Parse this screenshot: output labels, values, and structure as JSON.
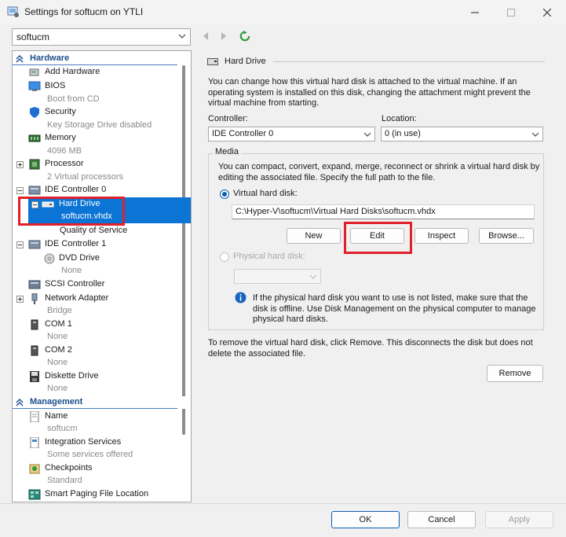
{
  "window": {
    "title": "Settings for softucm on YTLI",
    "controls": {
      "minimize": "minimize-icon",
      "maximize": "maximize-icon",
      "close": "close-icon"
    }
  },
  "toolbar": {
    "vm_selector_value": "softucm",
    "icons": [
      "back-arrow-icon",
      "forward-arrow-icon",
      "refresh-icon"
    ]
  },
  "tree": {
    "hardware_section": "Hardware",
    "management_section": "Management",
    "items": {
      "add_hardware": "Add Hardware",
      "bios": "BIOS",
      "bios_sub": "Boot from CD",
      "security": "Security",
      "security_sub": "Key Storage Drive disabled",
      "memory": "Memory",
      "memory_sub": "4096 MB",
      "processor": "Processor",
      "processor_sub": "2 Virtual processors",
      "ide0": "IDE Controller 0",
      "hard_drive": "Hard Drive",
      "hard_drive_sub": "softucm.vhdx",
      "qos": "Quality of Service",
      "ide1": "IDE Controller 1",
      "dvd": "DVD Drive",
      "dvd_sub": "None",
      "scsi": "SCSI Controller",
      "network": "Network Adapter",
      "network_sub": "Bridge",
      "com1": "COM 1",
      "com1_sub": "None",
      "com2": "COM 2",
      "com2_sub": "None",
      "diskette": "Diskette Drive",
      "diskette_sub": "None",
      "name": "Name",
      "name_sub": "softucm",
      "integration": "Integration Services",
      "integration_sub": "Some services offered",
      "checkpoints": "Checkpoints",
      "checkpoints_sub": "Standard",
      "smart_paging": "Smart Paging File Location"
    }
  },
  "detail": {
    "header": "Hard Drive",
    "intro": "You can change how this virtual hard disk is attached to the virtual machine. If an operating system is installed on this disk, changing the attachment might prevent the virtual machine from starting.",
    "controller_label": "Controller:",
    "controller_value": "IDE Controller 0",
    "location_label": "Location:",
    "location_value": "0 (in use)",
    "media_label": "Media",
    "media_text": "You can compact, convert, expand, merge, reconnect or shrink a virtual hard disk by editing the associated file. Specify the full path to the file.",
    "vhd_label": "Virtual hard disk:",
    "vhd_path": "C:\\Hyper-V\\softucm\\Virtual Hard Disks\\softucm.vhdx",
    "btn_new": "New",
    "btn_edit": "Edit",
    "btn_inspect": "Inspect",
    "btn_browse": "Browse...",
    "phys_label": "Physical hard disk:",
    "info_text": "If the physical hard disk you want to use is not listed, make sure that the disk is offline. Use Disk Management on the physical computer to manage physical hard disks.",
    "remove_text": "To remove the virtual hard disk, click Remove. This disconnects the disk but does not delete the associated file.",
    "btn_remove": "Remove"
  },
  "footer": {
    "ok": "OK",
    "cancel": "Cancel",
    "apply": "Apply"
  },
  "colors": {
    "selection": "#0b74d4",
    "section_text": "#1e4e8c",
    "highlight": "#e0202a"
  }
}
